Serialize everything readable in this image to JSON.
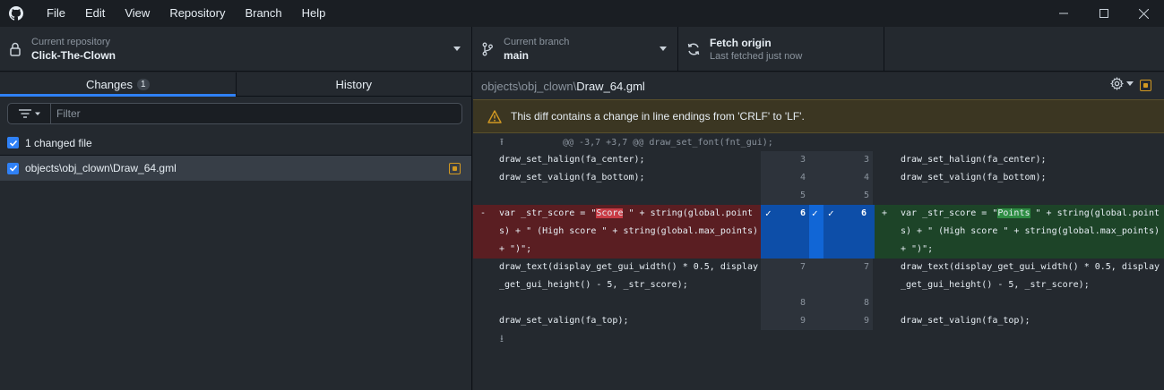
{
  "menu": [
    "File",
    "Edit",
    "View",
    "Repository",
    "Branch",
    "Help"
  ],
  "toolbar": {
    "repo_label": "Current repository",
    "repo_value": "Click-The-Clown",
    "branch_label": "Current branch",
    "branch_value": "main",
    "fetch_label": "Fetch origin",
    "fetch_sub": "Last fetched just now"
  },
  "sidebar": {
    "tab_changes": "Changes",
    "changes_count": "1",
    "tab_history": "History",
    "filter_placeholder": "Filter",
    "changed_files_label": "1 changed file",
    "file_path": "objects\\obj_clown\\Draw_64.gml"
  },
  "diff": {
    "path_dir": "objects\\obj_clown\\",
    "path_file": "Draw_64.gml",
    "warning": "This diff contains a change in line endings from 'CRLF' to 'LF'.",
    "hunk_header": "@@ -3,7 +3,7 @@ draw_set_font(fnt_gui);",
    "lines": [
      {
        "left": "draw_set_halign(fa_center);",
        "lnum": "3",
        "rnum": "3",
        "right": "draw_set_halign(fa_center);"
      },
      {
        "left": "draw_set_valign(fa_bottom);",
        "lnum": "4",
        "rnum": "4",
        "right": "draw_set_valign(fa_bottom);"
      },
      {
        "left": "",
        "lnum": "5",
        "rnum": "5",
        "right": ""
      }
    ],
    "changed": {
      "del_sign": "-",
      "add_sign": "+",
      "lnum": "6",
      "rnum": "6",
      "del_pre": "var _str_score = \"",
      "del_word": "Score",
      "del_post": " \" + string(global.point",
      "add_pre": "var _str_score = \"",
      "add_word": "Points",
      "add_post": " \" + string(global.point",
      "line2_left": "s) + \" (High score \" + string(global.max_points)",
      "line2_right": "s) + \" (High score \" + string(global.max_points)",
      "line3": "+ \")\";"
    },
    "after": [
      {
        "left": "draw_text(display_get_gui_width() * 0.5, display",
        "lnum": "7",
        "rnum": "7",
        "right": "draw_text(display_get_gui_width() * 0.5, display"
      },
      {
        "left": "_get_gui_height() - 5, _str_score);",
        "lnum": "",
        "rnum": "",
        "right": "_get_gui_height() - 5, _str_score);"
      },
      {
        "left": "",
        "lnum": "8",
        "rnum": "8",
        "right": ""
      },
      {
        "left": "draw_set_valign(fa_top);",
        "lnum": "9",
        "rnum": "9",
        "right": "draw_set_valign(fa_top);"
      }
    ]
  },
  "colors": {
    "accent": "#2f81f7",
    "deleted_bg": "#5a1e22",
    "added_bg": "#1d4428",
    "modified": "#d29922"
  }
}
